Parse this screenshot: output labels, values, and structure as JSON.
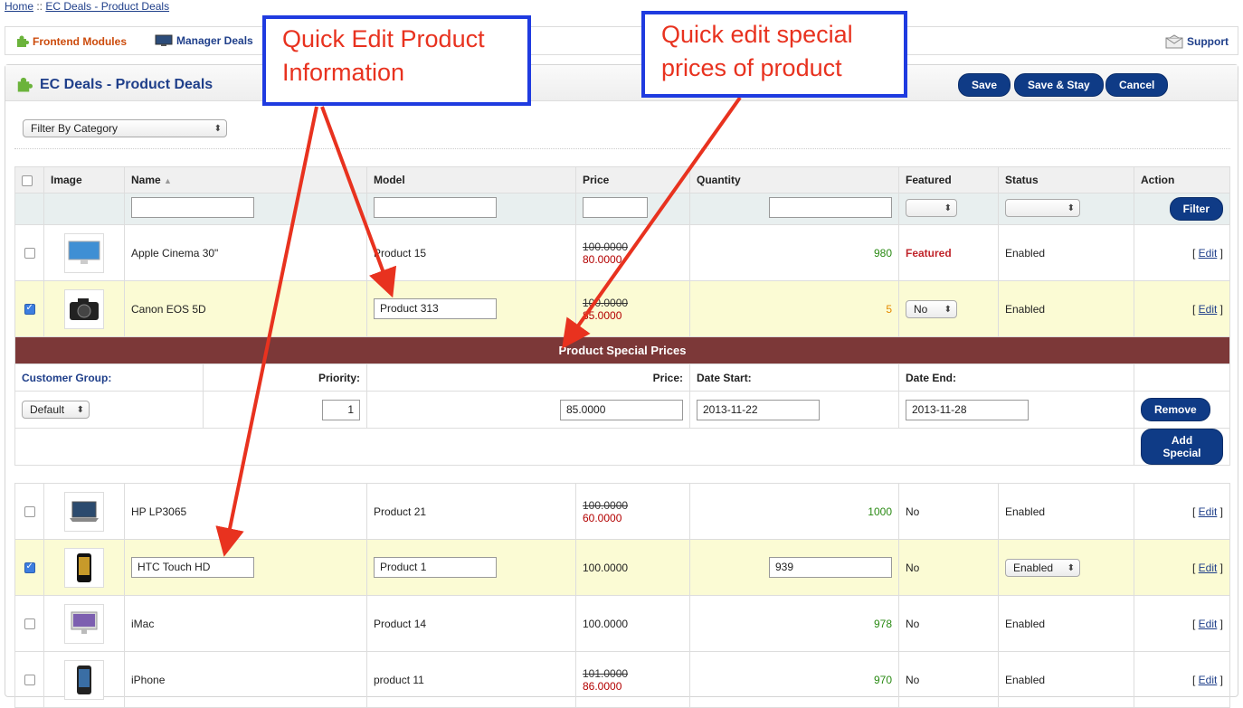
{
  "breadcrumb": {
    "home": "Home",
    "separator": " :: ",
    "current": "EC Deals - Product Deals"
  },
  "nav": {
    "frontend": "Frontend Modules",
    "manager": "Manager Deals",
    "support": "Support"
  },
  "panel": {
    "title": "EC Deals - Product Deals"
  },
  "buttons": {
    "save": "Save",
    "save_stay": "Save & Stay",
    "cancel": "Cancel",
    "filter": "Filter",
    "remove": "Remove",
    "add_special": "Add Special"
  },
  "filter_category": "Filter By Category",
  "table": {
    "headers": {
      "image": "Image",
      "name": "Name",
      "name_sort": "▲",
      "model": "Model",
      "price": "Price",
      "quantity": "Quantity",
      "featured": "Featured",
      "status": "Status",
      "action": "Action"
    },
    "edit_label": "Edit",
    "rows": [
      {
        "name": "Apple Cinema 30\"",
        "model": "Product 15",
        "price_old": "100.0000",
        "price_new": "80.0000",
        "quantity": "980",
        "featured": "Featured",
        "status": "Enabled",
        "image": "monitor"
      },
      {
        "name": "Canon EOS 5D",
        "model": "Product 313",
        "price_old": "100.0000",
        "price_new": "85.0000",
        "quantity": "5",
        "featured": "No",
        "status": "Enabled",
        "image": "camera"
      },
      {
        "name": "HP LP3065",
        "model": "Product 21",
        "price_old": "100.0000",
        "price_new": "60.0000",
        "quantity": "1000",
        "featured": "No",
        "status": "Enabled",
        "image": "laptop"
      },
      {
        "name": "HTC Touch HD",
        "model": "Product 1",
        "price": "100.0000",
        "quantity": "939",
        "featured": "No",
        "status": "Enabled",
        "image": "phone"
      },
      {
        "name": "iMac",
        "model": "Product 14",
        "price": "100.0000",
        "quantity": "978",
        "featured": "No",
        "status": "Enabled",
        "image": "imac"
      },
      {
        "name": "iPhone",
        "model": "product 11",
        "price_old": "101.0000",
        "price_new": "86.0000",
        "quantity": "970",
        "featured": "No",
        "status": "Enabled",
        "image": "iphone"
      }
    ]
  },
  "special": {
    "title": "Product Special Prices",
    "labels": {
      "customer_group": "Customer Group:",
      "priority": "Priority:",
      "price": "Price:",
      "date_start": "Date Start:",
      "date_end": "Date End:"
    },
    "values": {
      "customer_group": "Default",
      "priority": "1",
      "price": "85.0000",
      "date_start": "2013-11-22",
      "date_end": "2013-11-28"
    }
  },
  "annotations": {
    "quick_edit_info": [
      "Quick Edit Product",
      "Information"
    ],
    "quick_edit_special": [
      "Quick edit special",
      "prices of product"
    ]
  },
  "colors": {
    "accent_blue": "#0f3b86",
    "special_header": "#7c3838",
    "selected_row": "#fbfbd4",
    "annotation_border": "#1f3be0",
    "annotation_text": "#e8321f",
    "arrow": "#e8321f"
  }
}
